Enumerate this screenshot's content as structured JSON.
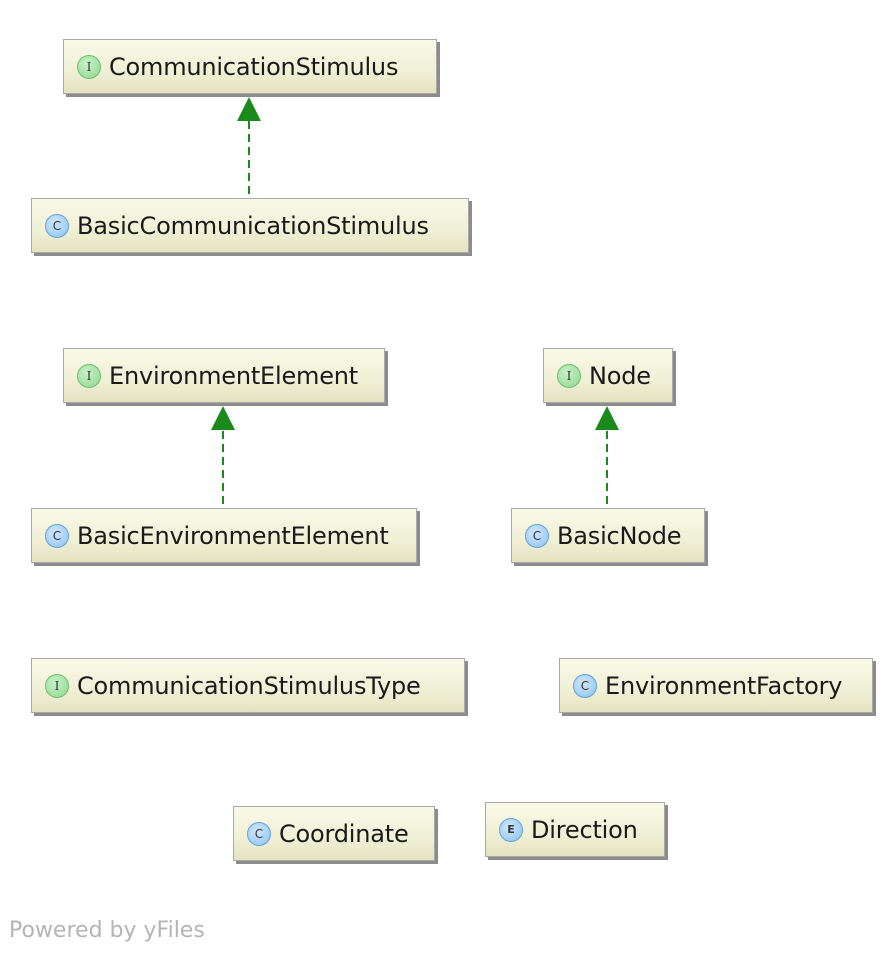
{
  "diagram": {
    "nodes": [
      {
        "id": "CommunicationStimulus",
        "kind": "I",
        "label": "CommunicationStimulus"
      },
      {
        "id": "BasicCommunicationStimulus",
        "kind": "C",
        "label": "BasicCommunicationStimulus"
      },
      {
        "id": "EnvironmentElement",
        "kind": "I",
        "label": "EnvironmentElement"
      },
      {
        "id": "Node",
        "kind": "I",
        "label": "Node"
      },
      {
        "id": "BasicEnvironmentElement",
        "kind": "C",
        "label": "BasicEnvironmentElement"
      },
      {
        "id": "BasicNode",
        "kind": "C",
        "label": "BasicNode"
      },
      {
        "id": "CommunicationStimulusType",
        "kind": "I",
        "label": "CommunicationStimulusType"
      },
      {
        "id": "EnvironmentFactory",
        "kind": "C",
        "label": "EnvironmentFactory"
      },
      {
        "id": "Coordinate",
        "kind": "C",
        "label": "Coordinate"
      },
      {
        "id": "Direction",
        "kind": "E",
        "label": "Direction"
      }
    ],
    "edges": [
      {
        "from": "BasicCommunicationStimulus",
        "to": "CommunicationStimulus",
        "type": "implements"
      },
      {
        "from": "BasicEnvironmentElement",
        "to": "EnvironmentElement",
        "type": "implements"
      },
      {
        "from": "BasicNode",
        "to": "Node",
        "type": "implements"
      }
    ],
    "badge_legend": {
      "I": "interface",
      "C": "class",
      "E": "enum"
    },
    "colors": {
      "edge": "#1a8a1a",
      "interface_badge": "#8fd68f",
      "class_badge": "#8cc4f0"
    }
  },
  "footer": {
    "text": "Powered by yFiles"
  }
}
